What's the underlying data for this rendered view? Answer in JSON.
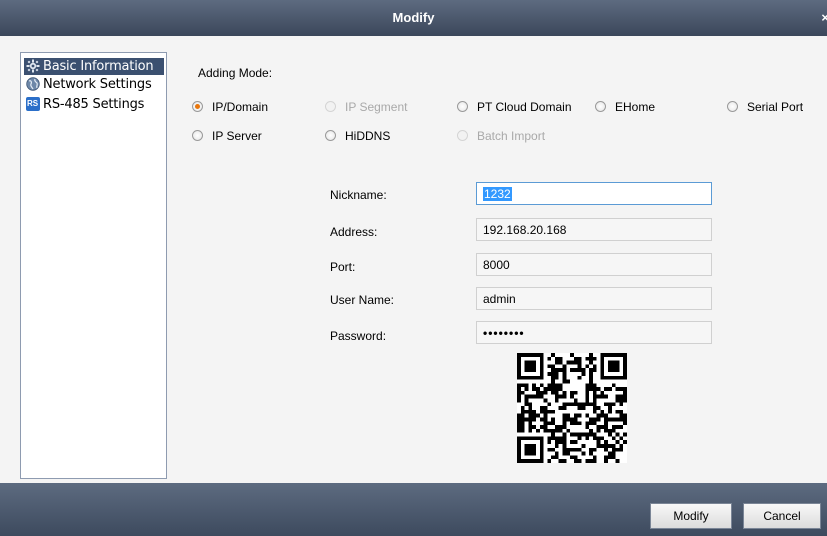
{
  "window": {
    "title": "Modify",
    "close_label": "×"
  },
  "sidebar": {
    "items": [
      {
        "label": "Basic Information",
        "icon": "gear-icon",
        "selected": true
      },
      {
        "label": "Network Settings",
        "icon": "globe-icon",
        "selected": false
      },
      {
        "label": "RS-485 Settings",
        "icon": "rs-icon",
        "selected": false
      }
    ],
    "rs_icon_text": "RS"
  },
  "adding_mode": {
    "label": "Adding Mode:",
    "options": [
      {
        "label": "IP/Domain",
        "checked": true,
        "enabled": true
      },
      {
        "label": "IP Segment",
        "checked": false,
        "enabled": false
      },
      {
        "label": "PT Cloud Domain",
        "checked": false,
        "enabled": true
      },
      {
        "label": "EHome",
        "checked": false,
        "enabled": true
      },
      {
        "label": "Serial Port",
        "checked": false,
        "enabled": true
      },
      {
        "label": "IP Server",
        "checked": false,
        "enabled": true
      },
      {
        "label": "HiDDNS",
        "checked": false,
        "enabled": true
      },
      {
        "label": "Batch Import",
        "checked": false,
        "enabled": false
      }
    ]
  },
  "form": {
    "nickname": {
      "label": "Nickname:",
      "value": "1232"
    },
    "address": {
      "label": "Address:",
      "value": "192.168.20.168"
    },
    "port": {
      "label": "Port:",
      "value": "8000"
    },
    "username": {
      "label": "User Name:",
      "value": "admin"
    },
    "password": {
      "label": "Password:",
      "value": "••••••••"
    }
  },
  "buttons": {
    "modify": "Modify",
    "cancel": "Cancel"
  },
  "colors": {
    "titlebar": "#4a576b",
    "selected_item": "#3b5070",
    "radio_checked": "#e8760c",
    "focus_border": "#5b9bd5"
  }
}
